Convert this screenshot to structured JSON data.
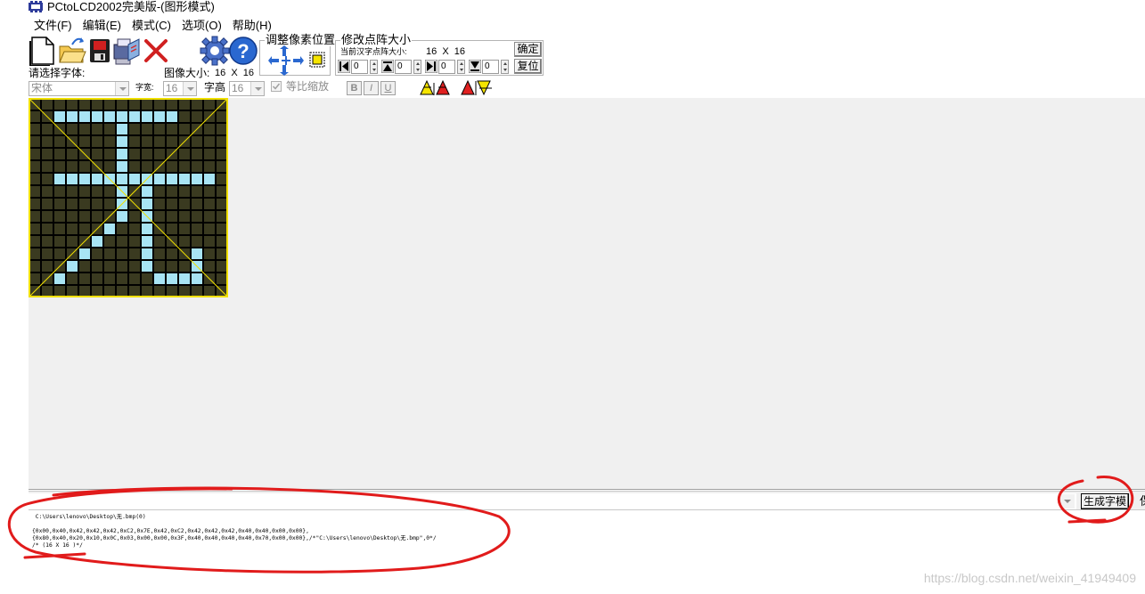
{
  "window": {
    "title": "PCtoLCD2002完美版-(图形模式)"
  },
  "menu": [
    "文件(F)",
    "编辑(E)",
    "模式(C)",
    "选项(O)",
    "帮助(H)"
  ],
  "toolbar": {
    "pixel_group_title": "调整像素位置",
    "resize_group_title": "修改点阵大小",
    "current_size_label": "当前汉字点阵大小:",
    "current_size_value": "16  X  16",
    "confirm_label": "确定",
    "reset_label": "复位",
    "spin_values": [
      "0",
      "0",
      "0",
      "0"
    ],
    "font_label": "请选择字体:",
    "font_value": "宋体",
    "char_width_label": "字宽:",
    "char_width_value": "16",
    "char_height_label": "字高",
    "char_height_value": "16",
    "image_size_label": "图像大小:",
    "image_size_value": "16  X  16",
    "proportional_label": "等比缩放",
    "bold_label": "B",
    "italic_label": "I",
    "underline_label": "U"
  },
  "bitmap": {
    "rows": [
      "0000000000000000",
      "0011111111110000",
      "0000000100000000",
      "0000000100000000",
      "0000000100000000",
      "0000000100000000",
      "0011111111111110",
      "0000000101000000",
      "0000000101000000",
      "0000000101000000",
      "0000001001000000",
      "0000010001000000",
      "0000100001000100",
      "0001000001000100",
      "0010000000111100",
      "0000000000000000"
    ],
    "on_color": "#a8e4f4",
    "off_color": "#3a3a20",
    "grid_color": "#000000",
    "guide_color": "#f0e000"
  },
  "generate_button_label": "生成字模",
  "cut_text": "保",
  "output_lines": [
    " C:\\Users\\lenovo\\Desktop\\无.bmp(0)",
    "",
    "{0x00,0x40,0x42,0x42,0x42,0xC2,0x7E,0x42,0xC2,0x42,0x42,0x42,0x40,0x40,0x00,0x00},",
    "{0x80,0x40,0x20,0x10,0x0C,0x03,0x00,0x00,0x3F,0x40,0x40,0x40,0x40,0x70,0x00,0x00},/*\"C:\\Users\\lenovo\\Desktop\\无.bmp\",0*/",
    "/* (16 X 16 )*/"
  ],
  "watermark": "https://blog.csdn.net/weixin_41949409"
}
